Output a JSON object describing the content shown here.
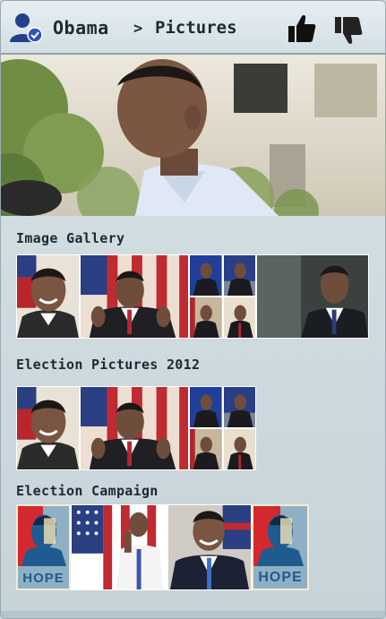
{
  "header": {
    "title": "Obama",
    "breadcrumb_separator": ">",
    "breadcrumb": "Pictures",
    "user_icon": "verified-user-icon",
    "like_icon": "thumbs-up-icon",
    "dislike_icon": "thumbs-down-icon"
  },
  "sections": [
    {
      "title": "Image Gallery"
    },
    {
      "title": "Election Pictures 2012"
    },
    {
      "title": "Election Campaign"
    }
  ],
  "posters": {
    "caption": "HOPE"
  },
  "colors": {
    "accent": "#2a4b8f",
    "header_text": "#1b2a33",
    "background": "#cdd9de",
    "poster_red": "#d4282f",
    "poster_blue": "#1f5b8f",
    "poster_cream": "#f1e4b8"
  }
}
